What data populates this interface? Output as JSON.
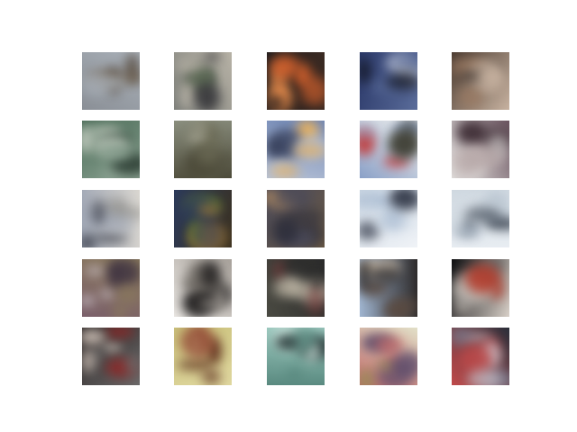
{
  "figure": {
    "rows": 5,
    "cols": 5,
    "background": "#ffffff",
    "samples": [
      {
        "row": 0,
        "col": 0,
        "subject": "animal-on-grass",
        "palette": [
          "#8a8f96",
          "#6b5a45",
          "#4a3b2c",
          "#a9b0b8"
        ]
      },
      {
        "row": 0,
        "col": 1,
        "subject": "dark-vehicle",
        "palette": [
          "#7d7f7a",
          "#3a3a3d",
          "#5c6a55",
          "#b7b2a6"
        ]
      },
      {
        "row": 0,
        "col": 2,
        "subject": "orange-object-on-dark",
        "palette": [
          "#1b1b1e",
          "#e0662e",
          "#f2924e",
          "#3b2a22"
        ]
      },
      {
        "row": 0,
        "col": 3,
        "subject": "blue-dark-scene",
        "palette": [
          "#2c3a6a",
          "#121521",
          "#c9d0e0",
          "#5a6c9a"
        ]
      },
      {
        "row": 0,
        "col": 4,
        "subject": "brown-texture",
        "palette": [
          "#4a3a30",
          "#9b7a62",
          "#2d2420",
          "#c7b2a0"
        ]
      },
      {
        "row": 1,
        "col": 0,
        "subject": "green-animal",
        "palette": [
          "#4a6b57",
          "#c0c9bd",
          "#2c3d33",
          "#8aa191"
        ]
      },
      {
        "row": 1,
        "col": 1,
        "subject": "grassy-field",
        "palette": [
          "#8a8e7e",
          "#6b6a55",
          "#b0b0a0",
          "#4d4b3a"
        ]
      },
      {
        "row": 1,
        "col": 2,
        "subject": "sunset-landscape",
        "palette": [
          "#6f86b5",
          "#e8b05a",
          "#2d3550",
          "#b7c2d6"
        ]
      },
      {
        "row": 1,
        "col": 3,
        "subject": "bright-scene",
        "palette": [
          "#f2f2ee",
          "#3a3a2f",
          "#c23b3b",
          "#8aa0c7"
        ]
      },
      {
        "row": 1,
        "col": 4,
        "subject": "purple-animal",
        "palette": [
          "#6b5560",
          "#b7a8a8",
          "#3c2b33",
          "#e3e1df"
        ]
      },
      {
        "row": 2,
        "col": 0,
        "subject": "bird-on-light",
        "palette": [
          "#d9d6d0",
          "#2c2f3a",
          "#8c8b87",
          "#a0a7b5"
        ]
      },
      {
        "row": 2,
        "col": 1,
        "subject": "colorful-abstract",
        "palette": [
          "#3a3020",
          "#c18a2a",
          "#6a8a2a",
          "#2c3a5a"
        ]
      },
      {
        "row": 2,
        "col": 2,
        "subject": "dark-bird",
        "palette": [
          "#6b5a45",
          "#2c2d3a",
          "#b08a60",
          "#4a4a5a"
        ]
      },
      {
        "row": 2,
        "col": 3,
        "subject": "white-sky-branch",
        "palette": [
          "#f0f3f7",
          "#2a3040",
          "#9fb3cc",
          "#c9d5e2"
        ]
      },
      {
        "row": 2,
        "col": 4,
        "subject": "pale-blue-figure",
        "palette": [
          "#e8edf2",
          "#3a4350",
          "#a9b7c6",
          "#cfd8e0"
        ]
      },
      {
        "row": 3,
        "col": 0,
        "subject": "mixed-clutter",
        "palette": [
          "#7a5f6a",
          "#c9c0c8",
          "#3a2f3f",
          "#8a7a5c"
        ]
      },
      {
        "row": 3,
        "col": 1,
        "subject": "dark-object",
        "palette": [
          "#eae7e3",
          "#1e1c1c",
          "#6b6660",
          "#a8a29b"
        ]
      },
      {
        "row": 3,
        "col": 2,
        "subject": "face-with-hat",
        "palette": [
          "#4a4a42",
          "#c9c0ae",
          "#7a3a3a",
          "#2a2a2a"
        ]
      },
      {
        "row": 3,
        "col": 3,
        "subject": "spiky-creature",
        "palette": [
          "#9fb4cf",
          "#5a4a40",
          "#c9b7a0",
          "#2d2a2a"
        ]
      },
      {
        "row": 3,
        "col": 4,
        "subject": "dark-vehicle-red",
        "palette": [
          "#0e0e10",
          "#b23a2a",
          "#5a5a5a",
          "#d8d0c8"
        ]
      },
      {
        "row": 4,
        "col": 0,
        "subject": "cluttered-dark",
        "palette": [
          "#2a2424",
          "#cfc2b8",
          "#8a2a2a",
          "#6b6a6a"
        ]
      },
      {
        "row": 4,
        "col": 1,
        "subject": "horse-yellow-field",
        "palette": [
          "#c9c07a",
          "#5a2a1a",
          "#8a3a2a",
          "#e0d8a0"
        ]
      },
      {
        "row": 4,
        "col": 2,
        "subject": "teal-bird",
        "palette": [
          "#9bc8be",
          "#2a3a3a",
          "#d8e8e2",
          "#5a8a80"
        ]
      },
      {
        "row": 4,
        "col": 3,
        "subject": "light-creature",
        "palette": [
          "#e2e0c8",
          "#5a4a6a",
          "#9a8a5a",
          "#c06a6a"
        ]
      },
      {
        "row": 4,
        "col": 4,
        "subject": "dark-frame-scene",
        "palette": [
          "#2a2f3a",
          "#c9c0c8",
          "#7a8aa0",
          "#c04a4a"
        ]
      }
    ]
  }
}
